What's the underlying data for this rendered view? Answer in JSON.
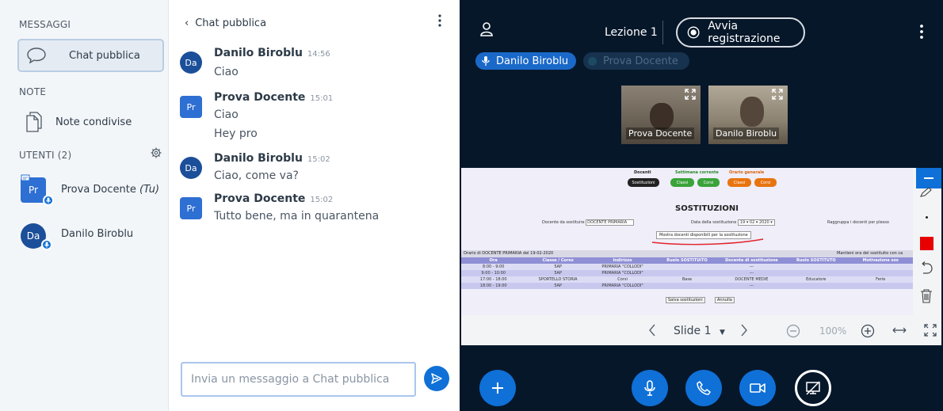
{
  "sidebar": {
    "messages_label": "MESSAGGI",
    "public_chat": "Chat pubblica",
    "notes_label": "NOTE",
    "shared_notes": "Note condivise",
    "users_label": "UTENTI (2)",
    "users": [
      {
        "initials": "Pr",
        "name": "Prova Docente",
        "suffix": "(Tu)"
      },
      {
        "initials": "Da",
        "name": "Danilo Biroblu"
      }
    ]
  },
  "chat": {
    "title": "Chat pubblica",
    "messages": [
      {
        "initials": "Da",
        "author": "Danilo Biroblu",
        "time": "14:56",
        "lines": [
          "Ciao"
        ]
      },
      {
        "initials": "Pr",
        "author": "Prova Docente",
        "time": "15:01",
        "lines": [
          "Ciao",
          "Hey pro"
        ]
      },
      {
        "initials": "Da",
        "author": "Danilo Biroblu",
        "time": "15:02",
        "lines": [
          "Ciao, come va?"
        ]
      },
      {
        "initials": "Pr",
        "author": "Prova Docente",
        "time": "15:02",
        "lines": [
          "Tutto bene, ma in quarantena"
        ]
      }
    ],
    "input_placeholder": "Invia un messaggio a Chat pubblica"
  },
  "main": {
    "lesson_title": "Lezione 1",
    "record_label": "Avvia registrazione",
    "talking": [
      "Danilo Biroblu",
      "Prova Docente"
    ],
    "videos": [
      "Prova Docente",
      "Danilo Biroblu"
    ],
    "slide": {
      "nav": {
        "docenti": "Docenti",
        "settimana": "Settimana corrente",
        "orario": "Orario generale"
      },
      "btns": [
        "Sostituzioni",
        "Classi",
        "Corsi",
        "Classi",
        "Corsi"
      ],
      "heading": "SOSTITUZIONI",
      "filter_docente": "Docente da sostituire",
      "filter_docente_val": "DOCENTE PRIMARIA",
      "filter_data": "Data della sostituzione",
      "filter_data_val": "19 ▾ 02 ▾ 2020 ▾",
      "raggruppa": "Raggruppa i docenti per plesso",
      "mostra": "Mostra docenti disponibili per la sostituzione",
      "orario_title": "Orario di DOCENTE PRIMARIA del 19-02-2020",
      "mantieni": "Mantieni ora del sostituito con ca",
      "headers": [
        "Ora",
        "Classe / Corso",
        "Indirizzo",
        "Ruolo SOSTITUITO",
        "Docente di sostituzione",
        "Ruolo SOSTITUTO",
        "Motivazione sos"
      ],
      "rows": [
        [
          "8:00 - 9:00",
          "5AP",
          "PRIMARIA \"COLLODI\"",
          "",
          "---",
          "",
          ""
        ],
        [
          "9:00 - 10:00",
          "5AP",
          "PRIMARIA \"COLLODI\"",
          "",
          "---",
          "",
          ""
        ],
        [
          "17:00 - 18:00",
          "SPORTELLO STORIA",
          "Corsi",
          "Base",
          "DOCENTE MEDIE",
          "Educatore",
          "Ferie"
        ],
        [
          "18:00 - 19:00",
          "5AP",
          "PRIMARIA \"COLLODI\"",
          "",
          "---",
          "",
          ""
        ]
      ],
      "salva": "Salva sostituzioni",
      "annulla": "Annulla"
    },
    "slide_label": "Slide 1",
    "zoom": "100%"
  },
  "colors": {
    "accent": "#0f70d7",
    "bg_dark": "#06172a"
  }
}
